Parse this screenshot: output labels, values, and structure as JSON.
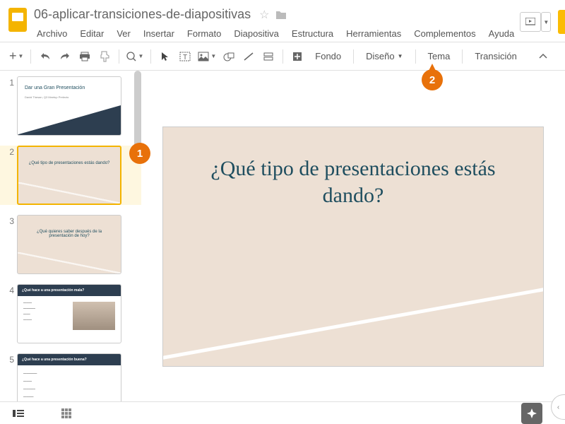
{
  "doc_title": "06-aplicar-transiciones-de-diapositivas",
  "menu": [
    "Archivo",
    "Editar",
    "Ver",
    "Insertar",
    "Formato",
    "Diapositiva",
    "Estructura",
    "Herramientas",
    "Complementos",
    "Ayuda"
  ],
  "toolbar_text": {
    "fondo": "Fondo",
    "diseno": "Diseño",
    "tema": "Tema",
    "transicion": "Transición"
  },
  "slides": [
    {
      "num": "1",
      "title": "Dar una Gran Presentación",
      "sub": "David Thesan, Q3 Meetup Prelecto"
    },
    {
      "num": "2",
      "title": "¿Qué tipo de presentaciones estás dando?"
    },
    {
      "num": "3",
      "title": "¿Qué quieres saber después de la presentación de hoy?"
    },
    {
      "num": "4",
      "title": "¿Qué hace a una presentación mala?"
    },
    {
      "num": "5",
      "title": "¿Qué hace a una presentación buena?"
    }
  ],
  "selected_slide_index": 1,
  "canvas_title": "¿Qué tipo de presentaciones estás dando?",
  "markers": {
    "m1": "1",
    "m2": "2"
  },
  "colors": {
    "accent": "#f4b400",
    "dark": "#2d3e50",
    "beige": "#ede0d4",
    "teal_text": "#1f4e5f",
    "marker": "#e8710a"
  }
}
